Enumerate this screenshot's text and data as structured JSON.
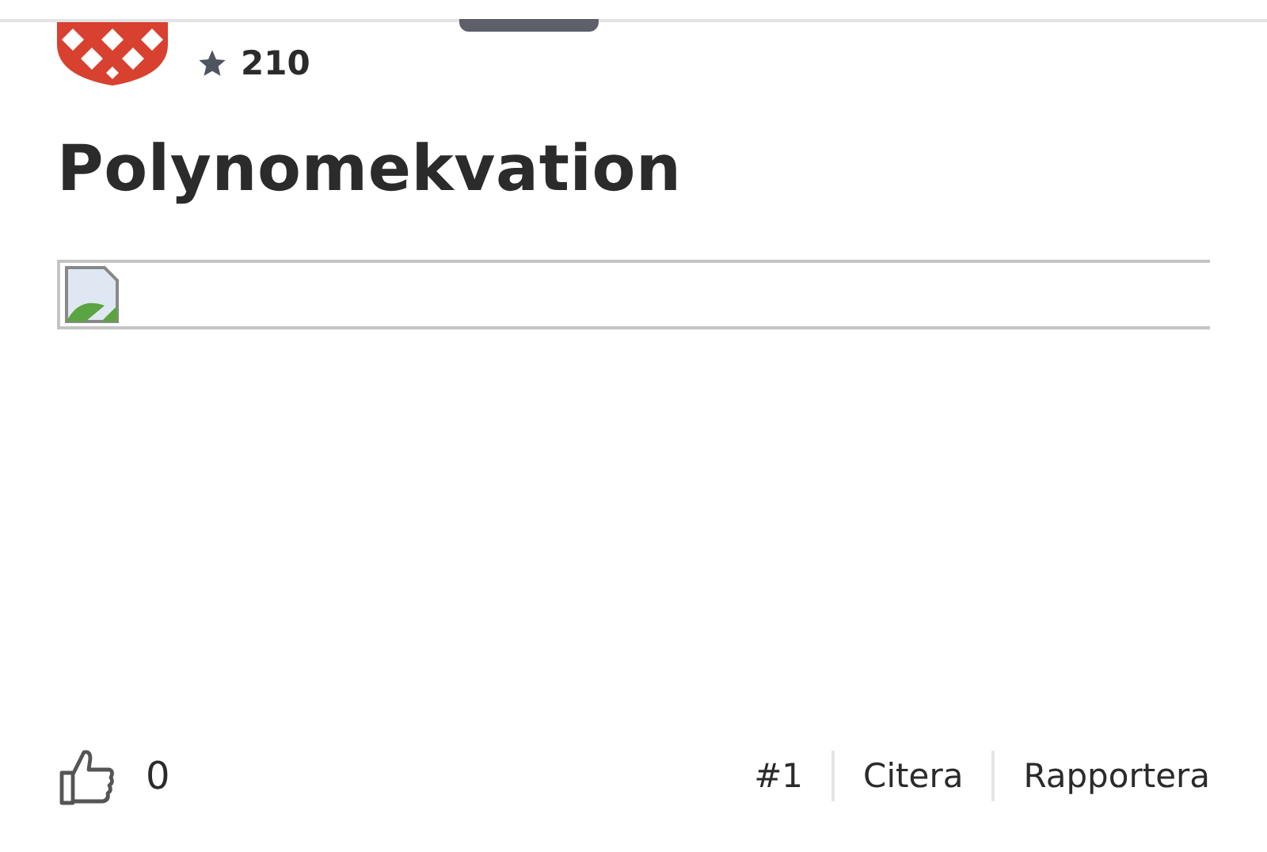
{
  "author": {
    "points": "210"
  },
  "post": {
    "title": "Polynomekvation",
    "likes": "0",
    "number": "#1",
    "actions": [
      "Citera",
      "Rapportera"
    ]
  }
}
